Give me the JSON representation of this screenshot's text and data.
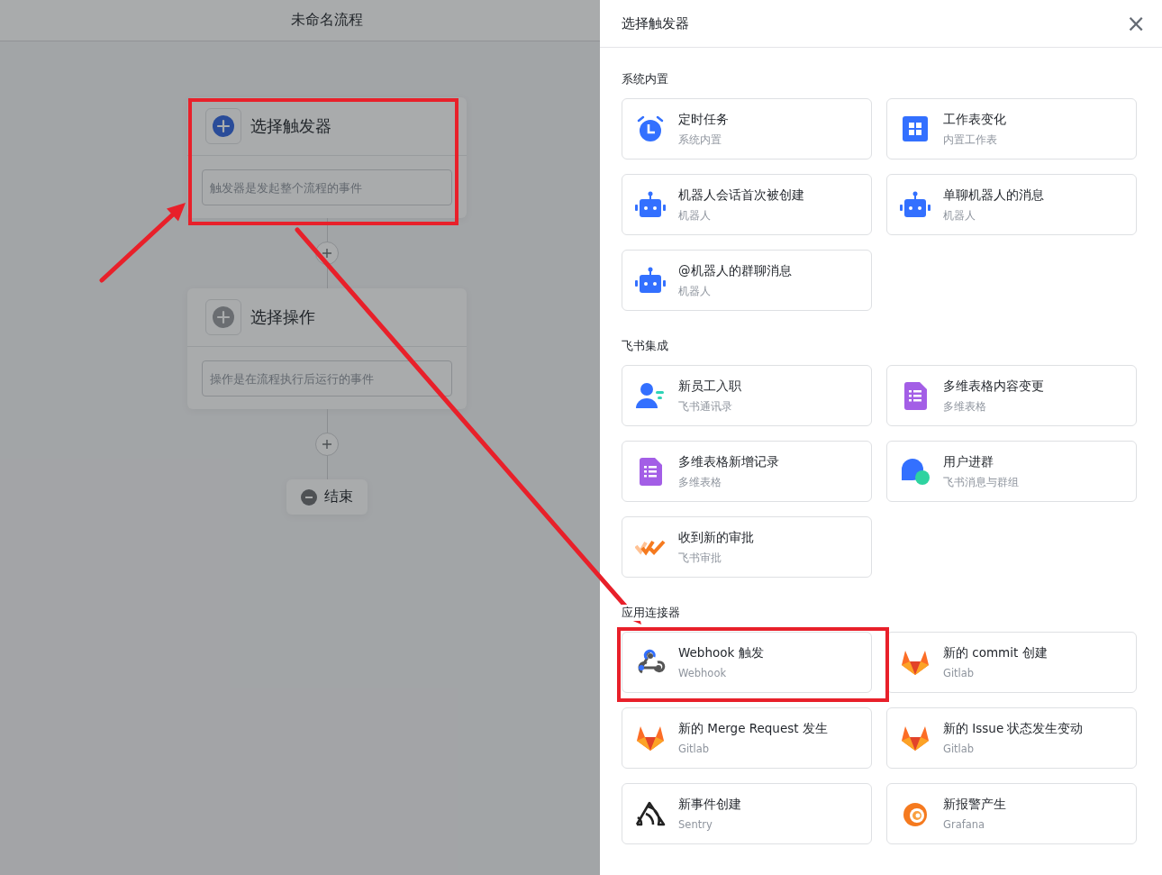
{
  "flow": {
    "title": "未命名流程",
    "nodes": [
      {
        "title": "选择触发器",
        "placeholder": "触发器是发起整个流程的事件",
        "active": true,
        "highlighted": true
      },
      {
        "title": "选择操作",
        "placeholder": "操作是在流程执行后运行的事件",
        "active": false,
        "highlighted": false
      }
    ],
    "end_label": "结束"
  },
  "drawer": {
    "title": "选择触发器",
    "close": "×",
    "sections": [
      {
        "title": "系统内置",
        "cards": [
          {
            "kind": "alarm",
            "title": "定时任务",
            "subtitle": "系统内置",
            "highlighted": false
          },
          {
            "kind": "grid",
            "title": "工作表变化",
            "subtitle": "内置工作表",
            "highlighted": false
          },
          {
            "kind": "robot",
            "title": "机器人会话首次被创建",
            "subtitle": "机器人",
            "highlighted": false
          },
          {
            "kind": "robot",
            "title": "单聊机器人的消息",
            "subtitle": "机器人",
            "highlighted": false
          },
          {
            "kind": "robot",
            "title": "@机器人的群聊消息",
            "subtitle": "机器人",
            "highlighted": false
          }
        ]
      },
      {
        "title": "飞书集成",
        "cards": [
          {
            "kind": "person",
            "title": "新员工入职",
            "subtitle": "飞书通讯录",
            "highlighted": false
          },
          {
            "kind": "sheet",
            "title": "多维表格内容变更",
            "subtitle": "多维表格",
            "highlighted": false
          },
          {
            "kind": "sheet",
            "title": "多维表格新增记录",
            "subtitle": "多维表格",
            "highlighted": false
          },
          {
            "kind": "chat",
            "title": "用户进群",
            "subtitle": "飞书消息与群组",
            "highlighted": false
          },
          {
            "kind": "approval",
            "title": "收到新的审批",
            "subtitle": "飞书审批",
            "highlighted": false
          }
        ]
      },
      {
        "title": "应用连接器",
        "cards": [
          {
            "kind": "webhook",
            "title": "Webhook 触发",
            "subtitle": "Webhook",
            "highlighted": true
          },
          {
            "kind": "fox",
            "title": "新的 commit 创建",
            "subtitle": "Gitlab",
            "highlighted": false
          },
          {
            "kind": "fox",
            "title": "新的 Merge Request 发生",
            "subtitle": "Gitlab",
            "highlighted": false
          },
          {
            "kind": "fox",
            "title": "新的 Issue 状态发生变动",
            "subtitle": "Gitlab",
            "highlighted": false
          },
          {
            "kind": "sentry",
            "title": "新事件创建",
            "subtitle": "Sentry",
            "highlighted": false
          },
          {
            "kind": "swirl",
            "title": "新报警产生",
            "subtitle": "Grafana",
            "highlighted": false
          }
        ]
      }
    ]
  }
}
